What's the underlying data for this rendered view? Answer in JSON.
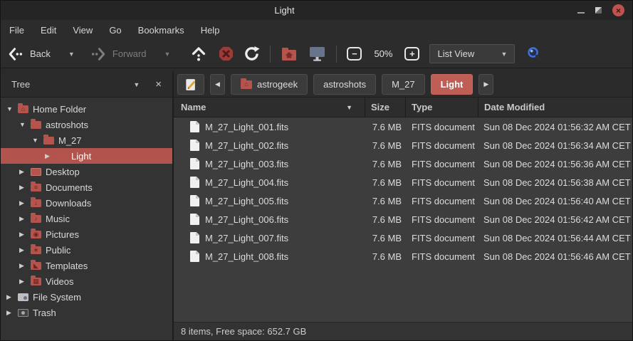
{
  "window": {
    "title": "Light"
  },
  "menu": {
    "items": [
      "File",
      "Edit",
      "View",
      "Go",
      "Bookmarks",
      "Help"
    ]
  },
  "toolbar": {
    "back_label": "Back",
    "forward_label": "Forward",
    "zoom_out_glyph": "−",
    "zoom_level": "50%",
    "zoom_in_glyph": "+",
    "view_mode": "List View"
  },
  "sidebar": {
    "header": {
      "title": "Tree"
    },
    "items": [
      {
        "label": "Home Folder",
        "level": 0,
        "state": "expanded",
        "selected": false,
        "icon": "home-folder",
        "emblem": "⌂"
      },
      {
        "label": "astroshots",
        "level": 1,
        "state": "expanded",
        "selected": false,
        "icon": "folder",
        "emblem": ""
      },
      {
        "label": "M_27",
        "level": 2,
        "state": "expanded",
        "selected": false,
        "icon": "folder",
        "emblem": ""
      },
      {
        "label": "Light",
        "level": 3,
        "state": "collapsed",
        "selected": true,
        "icon": "folder",
        "emblem": ""
      },
      {
        "label": "Desktop",
        "level": 1,
        "state": "collapsed",
        "selected": false,
        "icon": "desktop",
        "emblem": ""
      },
      {
        "label": "Documents",
        "level": 1,
        "state": "collapsed",
        "selected": false,
        "icon": "folder-documents",
        "emblem": "≡"
      },
      {
        "label": "Downloads",
        "level": 1,
        "state": "collapsed",
        "selected": false,
        "icon": "folder-downloads",
        "emblem": "↓"
      },
      {
        "label": "Music",
        "level": 1,
        "state": "collapsed",
        "selected": false,
        "icon": "folder-music",
        "emblem": "♪"
      },
      {
        "label": "Pictures",
        "level": 1,
        "state": "collapsed",
        "selected": false,
        "icon": "folder-pictures",
        "emblem": "◉"
      },
      {
        "label": "Public",
        "level": 1,
        "state": "collapsed",
        "selected": false,
        "icon": "folder-public",
        "emblem": "∗"
      },
      {
        "label": "Templates",
        "level": 1,
        "state": "collapsed",
        "selected": false,
        "icon": "folder-templates",
        "emblem": "◣"
      },
      {
        "label": "Videos",
        "level": 1,
        "state": "collapsed",
        "selected": false,
        "icon": "folder-videos",
        "emblem": "▦"
      },
      {
        "label": "File System",
        "level": 0,
        "state": "collapsed",
        "selected": false,
        "icon": "drive",
        "emblem": ""
      },
      {
        "label": "Trash",
        "level": 0,
        "state": "collapsed",
        "selected": false,
        "icon": "trash",
        "emblem": ""
      }
    ]
  },
  "pathbar": {
    "crumbs": [
      {
        "label": "astrogeek",
        "current": false,
        "icon": "home-folder"
      },
      {
        "label": "astroshots",
        "current": false
      },
      {
        "label": "M_27",
        "current": false
      },
      {
        "label": "Light",
        "current": true
      }
    ]
  },
  "list": {
    "columns": {
      "name": "Name",
      "size": "Size",
      "type": "Type",
      "modified": "Date Modified"
    },
    "sort": {
      "column": "Name",
      "direction": "desc"
    },
    "rows": [
      {
        "name": "M_27_Light_001.fits",
        "size": "7.6 MB",
        "type": "FITS document",
        "modified": "Sun 08 Dec 2024 01:56:32 AM CET"
      },
      {
        "name": "M_27_Light_002.fits",
        "size": "7.6 MB",
        "type": "FITS document",
        "modified": "Sun 08 Dec 2024 01:56:34 AM CET"
      },
      {
        "name": "M_27_Light_003.fits",
        "size": "7.6 MB",
        "type": "FITS document",
        "modified": "Sun 08 Dec 2024 01:56:36 AM CET"
      },
      {
        "name": "M_27_Light_004.fits",
        "size": "7.6 MB",
        "type": "FITS document",
        "modified": "Sun 08 Dec 2024 01:56:38 AM CET"
      },
      {
        "name": "M_27_Light_005.fits",
        "size": "7.6 MB",
        "type": "FITS document",
        "modified": "Sun 08 Dec 2024 01:56:40 AM CET"
      },
      {
        "name": "M_27_Light_006.fits",
        "size": "7.6 MB",
        "type": "FITS document",
        "modified": "Sun 08 Dec 2024 01:56:42 AM CET"
      },
      {
        "name": "M_27_Light_007.fits",
        "size": "7.6 MB",
        "type": "FITS document",
        "modified": "Sun 08 Dec 2024 01:56:44 AM CET"
      },
      {
        "name": "M_27_Light_008.fits",
        "size": "7.6 MB",
        "type": "FITS document",
        "modified": "Sun 08 Dec 2024 01:56:46 AM CET"
      }
    ]
  },
  "statusbar": {
    "text": "8 items, Free space: 652.7 GB"
  },
  "colors": {
    "selection_red": "#b2544e",
    "breadcrumb_red": "#bf5e55",
    "folder_red": "#b5534d",
    "search_blue": "#3f6fd8",
    "window_bg": "#2b2b2b",
    "list_bg": "#3d3d3d"
  }
}
